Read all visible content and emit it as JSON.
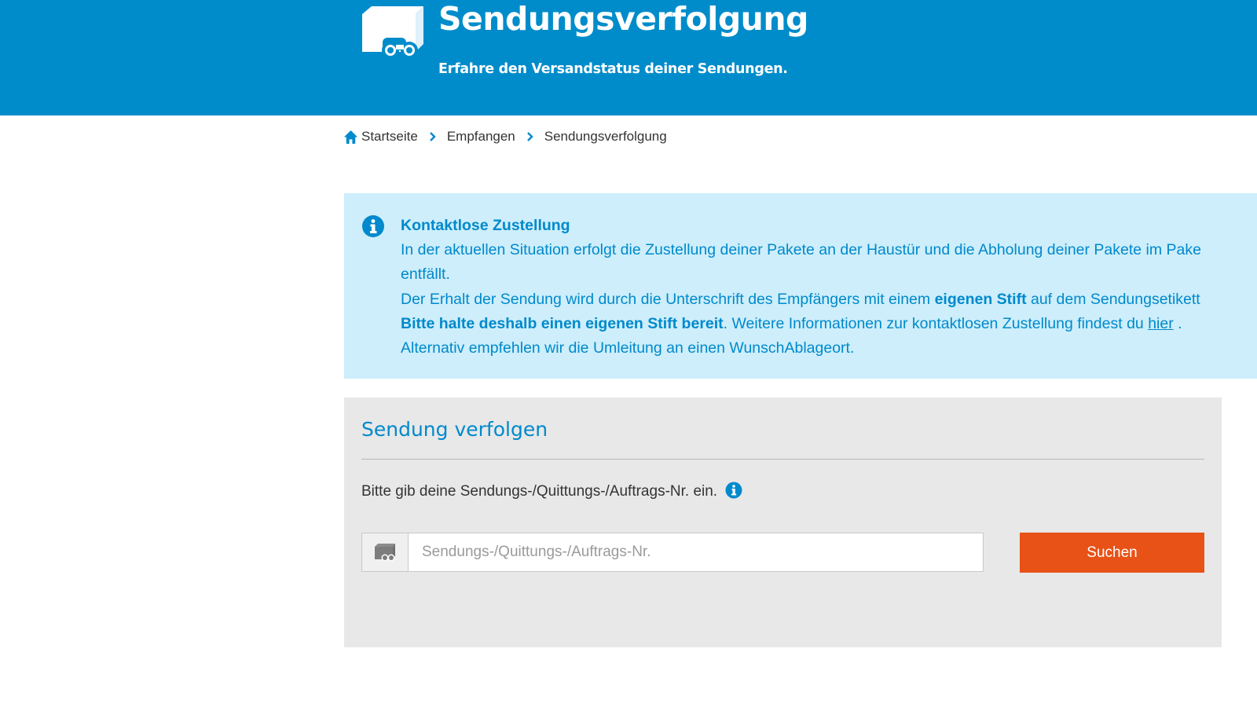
{
  "header": {
    "title": "Sendungsverfolgung",
    "subtitle": "Erfahre den Versandstatus deiner Sendungen."
  },
  "breadcrumb": {
    "items": [
      "Startseite",
      "Empfangen",
      "Sendungsverfolgung"
    ]
  },
  "info": {
    "title": "Kontaktlose Zustellung",
    "line1": "In der aktuellen Situation erfolgt die Zustellung deiner Pakete an der Haustür und die Abholung deiner Pakete im Pake",
    "line2": "entfällt.",
    "line3_pre": "Der Erhalt der Sendung wird durch die Unterschrift des Empfängers mit einem ",
    "line3_bold": "eigenen Stift",
    "line3_post": " auf dem Sendungsetikett",
    "line4_bold": "Bitte halte deshalb einen eigenen Stift bereit",
    "line4_mid": ". Weitere Informationen zur kontaktlosen Zustellung findest du ",
    "line4_link": "hier",
    "line4_end": " .",
    "line5": "Alternativ empfehlen wir die Umleitung an einen WunschAblageort."
  },
  "tracking": {
    "title": "Sendung verfolgen",
    "instruction": "Bitte gib deine Sendungs-/Quittungs-/Auftrags-Nr. ein.",
    "input_placeholder": "Sendungs-/Quittungs-/Auftrags-Nr.",
    "input_value": "",
    "button_label": "Suchen"
  },
  "colors": {
    "brand_blue": "#008cca",
    "info_background": "#cdeefa",
    "panel_background": "#e8e8e8",
    "button_orange": "#e85217"
  },
  "icons": {
    "logo": "package-binoculars-icon",
    "home": "home-icon",
    "separator": "chevron-right-icon",
    "info": "info-icon",
    "help": "info-icon",
    "input_addon": "package-binoculars-icon"
  }
}
